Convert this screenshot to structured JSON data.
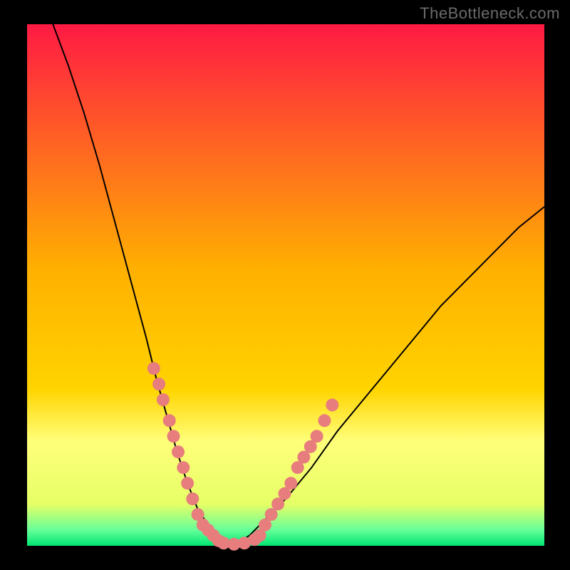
{
  "watermark": "TheBottleneck.com",
  "colors": {
    "frame": "#000000",
    "curve": "#000000",
    "dots": "#e77d7d",
    "gradient_top": "#ff1a44",
    "gradient_mid": "#ffd400",
    "gradient_band": "#ffff7a",
    "gradient_bottom": "#00e673"
  },
  "chart_data": {
    "type": "line",
    "title": "",
    "xlabel": "",
    "ylabel": "",
    "xlim": [
      0,
      100
    ],
    "ylim": [
      0,
      100
    ],
    "curve": {
      "name": "bottleneck-curve",
      "x": [
        5,
        8,
        11,
        14,
        17,
        20,
        23,
        25,
        27,
        29,
        31,
        33,
        35,
        37,
        40,
        43,
        46,
        50,
        55,
        60,
        65,
        70,
        75,
        80,
        85,
        90,
        95,
        100
      ],
      "y": [
        100,
        92,
        83,
        73,
        62,
        51,
        40,
        32,
        25,
        18,
        12,
        7,
        4,
        2,
        0,
        2,
        5,
        9,
        15,
        22,
        28,
        34,
        40,
        46,
        51,
        56,
        61,
        65
      ]
    },
    "series": [
      {
        "name": "left-branch-markers",
        "x": [
          24.5,
          25.5,
          26.3,
          27.5,
          28.3,
          29.2,
          30.2,
          31.0,
          32.0,
          33.0,
          34.0,
          35.0,
          36.0,
          37.0
        ],
        "y": [
          34,
          31,
          28,
          24,
          21,
          18,
          15,
          12,
          9,
          6,
          4,
          3,
          2,
          1
        ]
      },
      {
        "name": "valley-markers",
        "x": [
          38.0,
          40.0,
          42.0,
          44.0
        ],
        "y": [
          0.5,
          0.3,
          0.5,
          1.2
        ]
      },
      {
        "name": "right-branch-markers",
        "x": [
          45.0,
          46.0,
          47.2,
          48.5,
          49.8,
          51.0,
          52.3,
          53.5,
          54.8,
          56.0,
          57.5,
          59.0
        ],
        "y": [
          2,
          4,
          6,
          8,
          10,
          12,
          15,
          17,
          19,
          21,
          24,
          27
        ]
      }
    ],
    "gradient_stops": [
      {
        "offset": 0.0,
        "color": "#ff1a44"
      },
      {
        "offset": 0.47,
        "color": "#ffb000"
      },
      {
        "offset": 0.7,
        "color": "#ffd400"
      },
      {
        "offset": 0.8,
        "color": "#ffff7a"
      },
      {
        "offset": 0.92,
        "color": "#e6ff66"
      },
      {
        "offset": 0.97,
        "color": "#66ff99"
      },
      {
        "offset": 1.0,
        "color": "#00e673"
      }
    ]
  }
}
